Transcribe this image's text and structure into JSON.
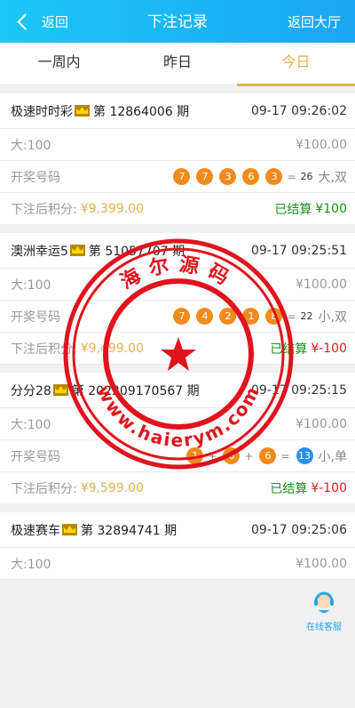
{
  "header": {
    "back_label": "返回",
    "title": "下注记录",
    "lobby_label": "返回大厅"
  },
  "tabs": [
    {
      "label": "一周内",
      "active": false
    },
    {
      "label": "昨日",
      "active": false
    },
    {
      "label": "今日",
      "active": true
    }
  ],
  "records": [
    {
      "game": "极速时时彩",
      "issue": "第 12864006 期",
      "time": "09-17 09:26:02",
      "bet": "大:100",
      "amount": "¥100.00",
      "draw_label": "开奖号码",
      "balls": [
        "7",
        "7",
        "3",
        "6",
        "3"
      ],
      "sum": "26",
      "result": "大,双",
      "after_label": "下注后积分:",
      "after_value": "¥9,399.00",
      "status": "已结算",
      "win": "¥100",
      "win_type": "green"
    },
    {
      "game": "澳洲幸运5",
      "issue": "第 51057707 期",
      "time": "09-17 09:25:51",
      "bet": "大:100",
      "amount": "¥100.00",
      "draw_label": "开奖号码",
      "balls": [
        "7",
        "4",
        "2",
        "1",
        "8"
      ],
      "sum": "22",
      "result": "小,双",
      "after_label": "下注后积分:",
      "after_value": "¥9,499.00",
      "status": "已结算",
      "win": "¥-100",
      "win_type": "red"
    },
    {
      "game": "分分28",
      "issue": "第 202309170567 期",
      "time": "09-17 09:25:15",
      "bet": "大:100",
      "amount": "¥100.00",
      "draw_label": "开奖号码",
      "balls": [
        "1",
        "6",
        "6"
      ],
      "sum": "13",
      "result": "小,单",
      "after_label": "下注后积分:",
      "after_value": "¥9,599.00",
      "status": "已结算",
      "win": "¥-100",
      "win_type": "red"
    },
    {
      "game": "极速赛车",
      "issue": "第 32894741 期",
      "time": "09-17 09:25:06",
      "bet": "大:100",
      "amount": "¥100.00"
    }
  ],
  "stamp": {
    "top_text": "海尔源码",
    "bottom_text": "www.haierym.com"
  },
  "service": {
    "label": "在线客服"
  },
  "colors": {
    "header": "#1ba7f2",
    "accent": "#e0b251",
    "ball": "#f28a1e",
    "sum_ball": "#2a8ff0",
    "win": "#1a8f1a",
    "loss": "#e02020",
    "stamp": "#e0141e"
  }
}
